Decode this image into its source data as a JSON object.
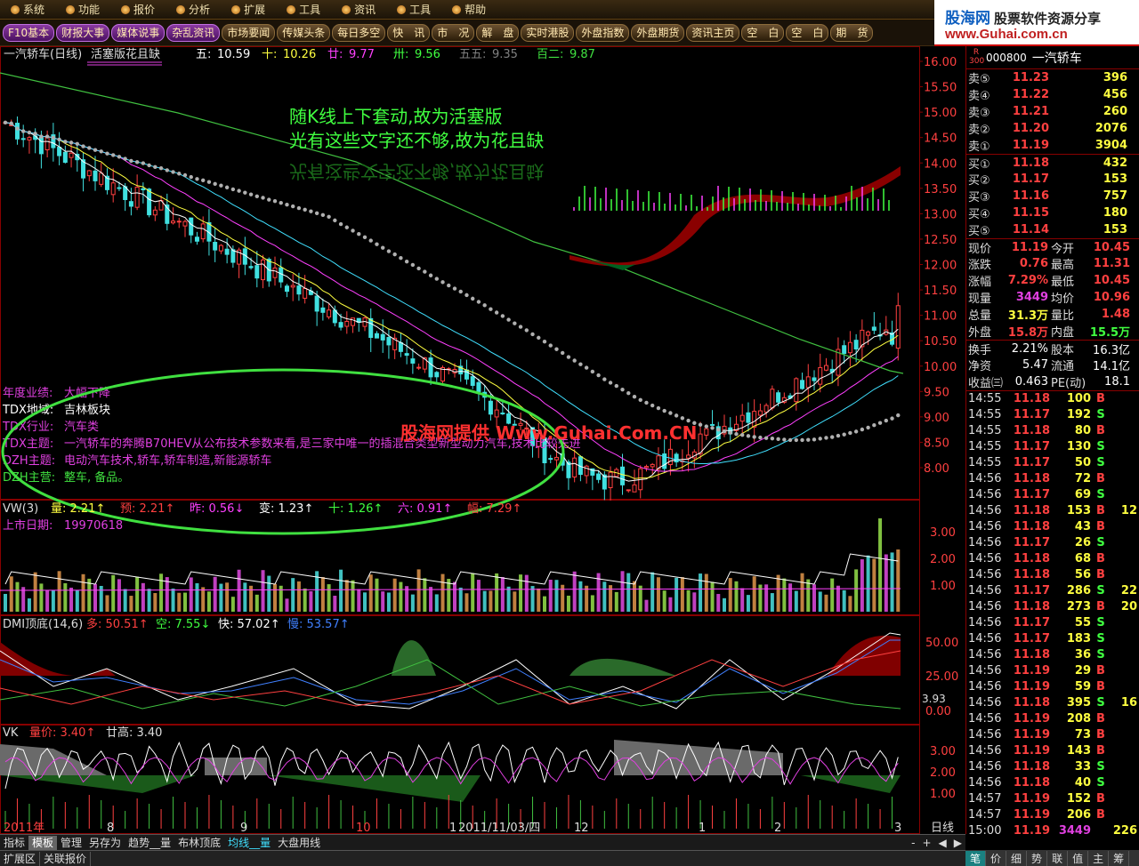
{
  "menubar": {
    "items": [
      "系统",
      "功能",
      "报价",
      "分析",
      "扩展",
      "工具",
      "资讯",
      "工具",
      "帮助"
    ]
  },
  "toolbar": {
    "buttons": [
      "F10基本",
      "财报大事",
      "媒体说事",
      "杂乱资讯",
      "市场要闻",
      "传媒头条",
      "每日多空",
      "快　讯",
      "市　况",
      "解　盘",
      "实时港股",
      "外盘指数",
      "外盘期货",
      "资讯主页",
      "空　白",
      "空　白",
      "期　货"
    ]
  },
  "brand": {
    "line1_a": "股海网",
    "line1_b": "股票软件资源分享",
    "line2": "www.Guhai.com.cn"
  },
  "chart": {
    "title": "一汽轿车(日线)",
    "subtitle": "活塞版花且缺",
    "ma": [
      {
        "label": "五:",
        "value": "10.59",
        "color": "#ffffff"
      },
      {
        "label": "十:",
        "value": "10.26",
        "color": "#ffff40"
      },
      {
        "label": "廿:",
        "value": "9.77",
        "color": "#ff40ff"
      },
      {
        "label": "卅:",
        "value": "9.56",
        "color": "#40ff40"
      },
      {
        "label": "五五:",
        "value": "9.35",
        "color": "#808080"
      },
      {
        "label": "百二:",
        "value": "9.87",
        "color": "#40e040"
      }
    ],
    "note1": "随K线上下套动,故为活塞版",
    "note2": "光有这些文字还不够,故为花且缺",
    "info_lines": [
      {
        "k": "年度业绩:",
        "v": "大幅下降",
        "kc": "#e040e0",
        "vc": "#e040e0"
      },
      {
        "k": "TDX地域:",
        "v": "吉林板块",
        "kc": "#ffffff",
        "vc": "#ffffff"
      },
      {
        "k": "TDX行业:",
        "v": "汽车类",
        "kc": "#e040e0",
        "vc": "#e040e0"
      },
      {
        "k": "TDX主题:",
        "v": "一汽轿车的奔腾B70HEV从公布技术参数来看,是三家中唯一的插混合类型新型动力汽车,技术比较先进",
        "kc": "#e040e0",
        "vc": "#e040e0"
      },
      {
        "k": "DZH主题:",
        "v": "电动汽车技术,轿车,轿车制造,新能源轿车",
        "kc": "#e040e0",
        "vc": "#e040e0"
      },
      {
        "k": "DZH主营:",
        "v": "整车, 备品。",
        "kc": "#40e040",
        "vc": "#40e040"
      }
    ],
    "watermark": "股海网提供 Www.Guhai.Com.CN",
    "price_ticks": [
      "16.00",
      "15.50",
      "15.00",
      "14.50",
      "14.00",
      "13.50",
      "13.00",
      "12.50",
      "12.00",
      "11.50",
      "11.00",
      "10.50",
      "10.00",
      "9.50",
      "9.00",
      "8.50",
      "8.00"
    ],
    "vol_header": [
      {
        "t": "VW(3)",
        "c": "#ddd"
      },
      {
        "t": "量: 2.21↑",
        "c": "#ffff40"
      },
      {
        "t": "预: 2.21↑",
        "c": "#ff4040"
      },
      {
        "t": "昨: 0.56↓",
        "c": "#ff40ff"
      },
      {
        "t": "变: 1.23↑",
        "c": "#ffffff"
      },
      {
        "t": "十: 1.26↑",
        "c": "#40ff40"
      },
      {
        "t": "六: 0.91↑",
        "c": "#ff40ff"
      },
      {
        "t": "幅: 7.29↑",
        "c": "#ff4040"
      }
    ],
    "vol_date_label": "上市日期:",
    "vol_date": "19970618",
    "vol_ticks": [
      "3.00",
      "2.00",
      "1.00"
    ],
    "dmi_header": [
      {
        "t": "DMI顶底(14,6)",
        "c": "#ddd"
      },
      {
        "t": "多: 50.51↑",
        "c": "#ff4040"
      },
      {
        "t": "空: 7.55↓",
        "c": "#40ff40"
      },
      {
        "t": "快: 57.02↑",
        "c": "#ffffff"
      },
      {
        "t": "慢: 53.57↑",
        "c": "#4080ff"
      }
    ],
    "dmi_ticks": [
      "50.00",
      "25.00",
      "0.00"
    ],
    "dmi_extra": "3.93",
    "vk_header": [
      {
        "t": "VK",
        "c": "#ddd"
      },
      {
        "t": "量价: 3.40↑",
        "c": "#ff4040"
      },
      {
        "t": "廿高: 3.40",
        "c": "#ddd"
      }
    ],
    "vk_ticks": [
      "3.00",
      "2.00",
      "1.00"
    ],
    "xaxis": [
      {
        "t": "2011年",
        "c": "#ff4040"
      },
      {
        "t": "8",
        "c": "#ddd"
      },
      {
        "t": "9",
        "c": "#ddd"
      },
      {
        "t": "10",
        "c": "#ff4040"
      },
      {
        "t": "1",
        "c": "#ddd"
      },
      {
        "t": "2011/11/03/四",
        "c": "#ddd"
      },
      {
        "t": "12",
        "c": "#ddd"
      },
      {
        "t": "1",
        "c": "#ddd"
      },
      {
        "t": "2",
        "c": "#ddd"
      },
      {
        "t": "3",
        "c": "#ddd"
      }
    ],
    "period": "日线"
  },
  "quote": {
    "code": "000800",
    "name": "一汽轿车",
    "sells": [
      {
        "l": "卖⑤",
        "p": "11.23",
        "v": "396"
      },
      {
        "l": "卖④",
        "p": "11.22",
        "v": "456"
      },
      {
        "l": "卖③",
        "p": "11.21",
        "v": "260"
      },
      {
        "l": "卖②",
        "p": "11.20",
        "v": "2076"
      },
      {
        "l": "卖①",
        "p": "11.19",
        "v": "3904"
      }
    ],
    "buys": [
      {
        "l": "买①",
        "p": "11.18",
        "v": "432"
      },
      {
        "l": "买②",
        "p": "11.17",
        "v": "153"
      },
      {
        "l": "买③",
        "p": "11.16",
        "v": "757"
      },
      {
        "l": "买④",
        "p": "11.15",
        "v": "180"
      },
      {
        "l": "买⑤",
        "p": "11.14",
        "v": "153"
      }
    ],
    "stats": [
      {
        "a": "现价",
        "b": "11.19",
        "bc": "#ff4040",
        "c": "今开",
        "d": "10.45",
        "dc": "#ff4040"
      },
      {
        "a": "涨跌",
        "b": "0.76",
        "bc": "#ff4040",
        "c": "最高",
        "d": "11.31",
        "dc": "#ff4040"
      },
      {
        "a": "涨幅",
        "b": "7.29%",
        "bc": "#ff4040",
        "c": "最低",
        "d": "10.45",
        "dc": "#ff4040"
      },
      {
        "a": "现量",
        "b": "3449",
        "bc": "#e040e0",
        "c": "均价",
        "d": "10.96",
        "dc": "#ff4040"
      },
      {
        "a": "总量",
        "b": "31.3万",
        "bc": "#ffff40",
        "c": "量比",
        "d": "1.48",
        "dc": "#ff4040"
      },
      {
        "a": "外盘",
        "b": "15.8万",
        "bc": "#ff4040",
        "c": "内盘",
        "d": "15.5万",
        "dc": "#40ff40"
      }
    ],
    "stats2": [
      {
        "a": "换手",
        "b": "2.21%",
        "c": "股本",
        "d": "16.3亿"
      },
      {
        "a": "净资",
        "b": "5.47",
        "c": "流通",
        "d": "14.1亿"
      },
      {
        "a": "收益㈢",
        "b": "0.463",
        "c": "PE(动)",
        "d": "18.1"
      }
    ],
    "ticks": [
      {
        "t": "14:55",
        "p": "11.18",
        "v": "100",
        "s": "B"
      },
      {
        "t": "14:55",
        "p": "11.17",
        "v": "192",
        "s": "S"
      },
      {
        "t": "14:55",
        "p": "11.18",
        "v": "80",
        "s": "B"
      },
      {
        "t": "14:55",
        "p": "11.17",
        "v": "130",
        "s": "S"
      },
      {
        "t": "14:55",
        "p": "11.17",
        "v": "50",
        "s": "S"
      },
      {
        "t": "14:56",
        "p": "11.18",
        "v": "72",
        "s": "B"
      },
      {
        "t": "14:56",
        "p": "11.17",
        "v": "69",
        "s": "S"
      },
      {
        "t": "14:56",
        "p": "11.18",
        "v": "153",
        "s": "B",
        "n": "12"
      },
      {
        "t": "14:56",
        "p": "11.18",
        "v": "43",
        "s": "B"
      },
      {
        "t": "14:56",
        "p": "11.17",
        "v": "26",
        "s": "S"
      },
      {
        "t": "14:56",
        "p": "11.18",
        "v": "68",
        "s": "B"
      },
      {
        "t": "14:56",
        "p": "11.18",
        "v": "56",
        "s": "B"
      },
      {
        "t": "14:56",
        "p": "11.17",
        "v": "286",
        "s": "S",
        "n": "22"
      },
      {
        "t": "14:56",
        "p": "11.18",
        "v": "273",
        "s": "B",
        "n": "20"
      },
      {
        "t": "14:56",
        "p": "11.17",
        "v": "55",
        "s": "S"
      },
      {
        "t": "14:56",
        "p": "11.17",
        "v": "183",
        "s": "S"
      },
      {
        "t": "14:56",
        "p": "11.18",
        "v": "36",
        "s": "S"
      },
      {
        "t": "14:56",
        "p": "11.19",
        "v": "29",
        "s": "B"
      },
      {
        "t": "14:56",
        "p": "11.19",
        "v": "59",
        "s": "B"
      },
      {
        "t": "14:56",
        "p": "11.18",
        "v": "395",
        "s": "S",
        "n": "16"
      },
      {
        "t": "14:56",
        "p": "11.19",
        "v": "208",
        "s": "B"
      },
      {
        "t": "14:56",
        "p": "11.19",
        "v": "73",
        "s": "B"
      },
      {
        "t": "14:56",
        "p": "11.19",
        "v": "143",
        "s": "B"
      },
      {
        "t": "14:56",
        "p": "11.18",
        "v": "33",
        "s": "S"
      },
      {
        "t": "14:56",
        "p": "11.18",
        "v": "40",
        "s": "S"
      },
      {
        "t": "14:57",
        "p": "11.19",
        "v": "152",
        "s": "B"
      },
      {
        "t": "14:57",
        "p": "11.19",
        "v": "206",
        "s": "B"
      },
      {
        "t": "15:00",
        "p": "11.19",
        "v": "3449",
        "s": "",
        "n": "226"
      }
    ]
  },
  "bottom": {
    "tabs": [
      "指标",
      "模板",
      "管理",
      "另存为",
      "趋势__量",
      "布林顶底",
      "均线__量",
      "大盘用线"
    ],
    "active": 1,
    "cyan": 6,
    "zoom_minus": "-",
    "zoom_plus": "+",
    "nav": [
      "◀",
      "▶"
    ]
  },
  "status": {
    "items": [
      "扩展区",
      "关联报价"
    ]
  },
  "rp_bottom": {
    "tabs": [
      "笔",
      "价",
      "细",
      "势",
      "联",
      "值",
      "主",
      "筹"
    ]
  }
}
